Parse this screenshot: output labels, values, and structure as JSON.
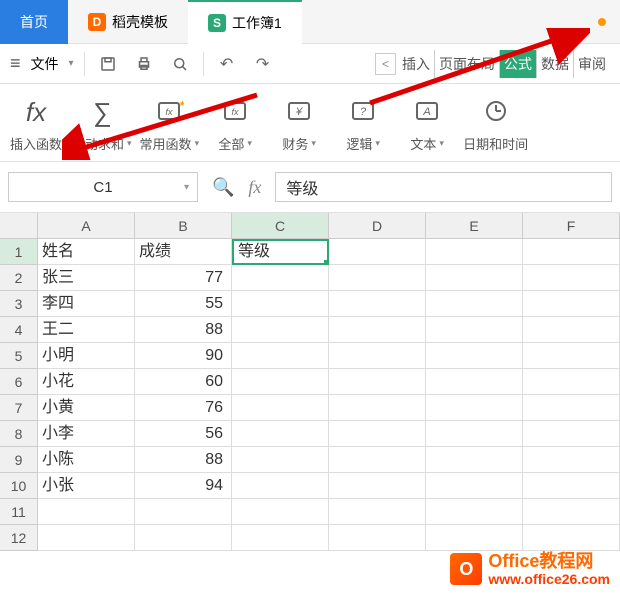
{
  "tabs": {
    "home": "首页",
    "template": "稻壳模板",
    "workbook": "工作簿1"
  },
  "toolbar": {
    "file": "文件",
    "mini": {
      "insert": "插入",
      "layout": "页面布局",
      "formula": "公式",
      "data": "数据",
      "review": "审阅"
    }
  },
  "ribbon": {
    "insert_fn": "插入函数",
    "autosum": "自动求和",
    "common": "常用函数",
    "all": "全部",
    "finance": "财务",
    "logic": "逻辑",
    "text": "文本",
    "datetime": "日期和时间"
  },
  "namebox": "C1",
  "formula": "等级",
  "columns": [
    "A",
    "B",
    "C",
    "D",
    "E",
    "F"
  ],
  "rows": [
    {
      "n": "1",
      "a": "姓名",
      "b": "成绩",
      "c": "等级"
    },
    {
      "n": "2",
      "a": "张三",
      "b": "77"
    },
    {
      "n": "3",
      "a": "李四",
      "b": "55"
    },
    {
      "n": "4",
      "a": "王二",
      "b": "88"
    },
    {
      "n": "5",
      "a": "小明",
      "b": "90"
    },
    {
      "n": "6",
      "a": "小花",
      "b": "60"
    },
    {
      "n": "7",
      "a": "小黄",
      "b": "76"
    },
    {
      "n": "8",
      "a": "小李",
      "b": "56"
    },
    {
      "n": "9",
      "a": "小陈",
      "b": "88"
    },
    {
      "n": "10",
      "a": "小张",
      "b": "94"
    },
    {
      "n": "11"
    },
    {
      "n": "12"
    }
  ],
  "watermark": {
    "title": "Office教程网",
    "url": "www.office26.com"
  },
  "chart_data": {
    "type": "table",
    "columns": [
      "姓名",
      "成绩",
      "等级"
    ],
    "rows": [
      [
        "张三",
        77,
        null
      ],
      [
        "李四",
        55,
        null
      ],
      [
        "王二",
        88,
        null
      ],
      [
        "小明",
        90,
        null
      ],
      [
        "小花",
        60,
        null
      ],
      [
        "小黄",
        76,
        null
      ],
      [
        "小李",
        56,
        null
      ],
      [
        "小陈",
        88,
        null
      ],
      [
        "小张",
        94,
        null
      ]
    ]
  }
}
